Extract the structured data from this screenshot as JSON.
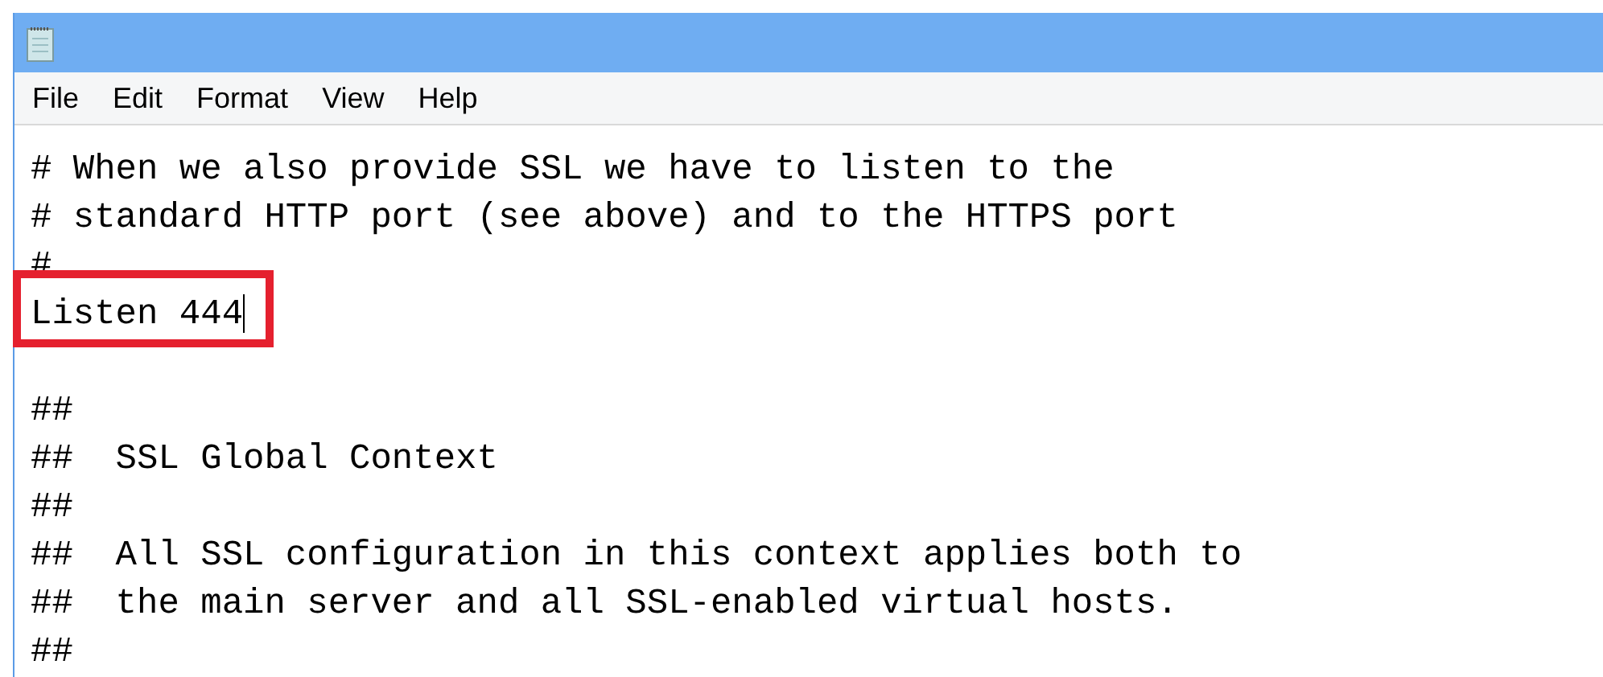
{
  "menu": [
    {
      "label": "File"
    },
    {
      "label": "Edit"
    },
    {
      "label": "Format"
    },
    {
      "label": "View"
    },
    {
      "label": "Help"
    }
  ],
  "editor": {
    "lines": [
      {
        "text": "# When we also provide SSL we have to listen to the",
        "highlighted": false,
        "caret": false
      },
      {
        "text": "# standard HTTP port (see above) and to the HTTPS port",
        "highlighted": false,
        "caret": false
      },
      {
        "text": "#",
        "highlighted": false,
        "caret": false
      },
      {
        "text": "Listen 444",
        "highlighted": true,
        "caret": true
      },
      {
        "highlighted": false,
        "caret": false
      },
      {
        "text": "##",
        "highlighted": false,
        "caret": false
      },
      {
        "text": "##  SSL Global Context",
        "highlighted": false,
        "caret": false
      },
      {
        "text": "##",
        "highlighted": false,
        "caret": false
      },
      {
        "text": "##  All SSL configuration in this context applies both to",
        "highlighted": false,
        "caret": false
      },
      {
        "text": "##  the main server and all SSL-enabled virtual hosts.",
        "highlighted": false,
        "caret": false
      },
      {
        "text": "##",
        "highlighted": false,
        "caret": false
      }
    ]
  }
}
